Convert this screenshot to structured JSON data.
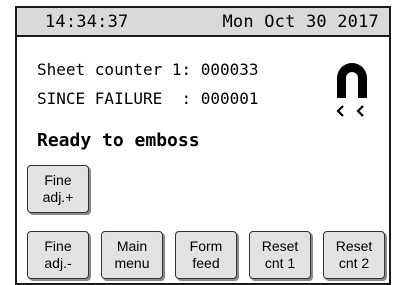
{
  "status_bar": {
    "time": "14:34:37",
    "date": "Mon Oct 30 2017"
  },
  "counters": {
    "line1": "Sheet counter 1: 000033",
    "line2": "SINCE FAILURE  : 000001"
  },
  "status_message": "Ready to emboss",
  "icons": {
    "magnet": "magnet-icon"
  },
  "buttons": {
    "fine_adj_up": {
      "line1": "Fine",
      "line2": "adj.+"
    },
    "fine_adj_down": {
      "line1": "Fine",
      "line2": "adj.-"
    },
    "main_menu": {
      "line1": "Main",
      "line2": "menu"
    },
    "form_feed": {
      "line1": "Form",
      "line2": "feed"
    },
    "reset_cnt_1": {
      "line1": "Reset",
      "line2": "cnt 1"
    },
    "reset_cnt_2": {
      "line1": "Reset",
      "line2": "cnt 2"
    }
  },
  "colors": {
    "status_bar_bg": "#d9d9d9",
    "button_bg": "#e2e2e2",
    "border": "#1a1a1a"
  }
}
